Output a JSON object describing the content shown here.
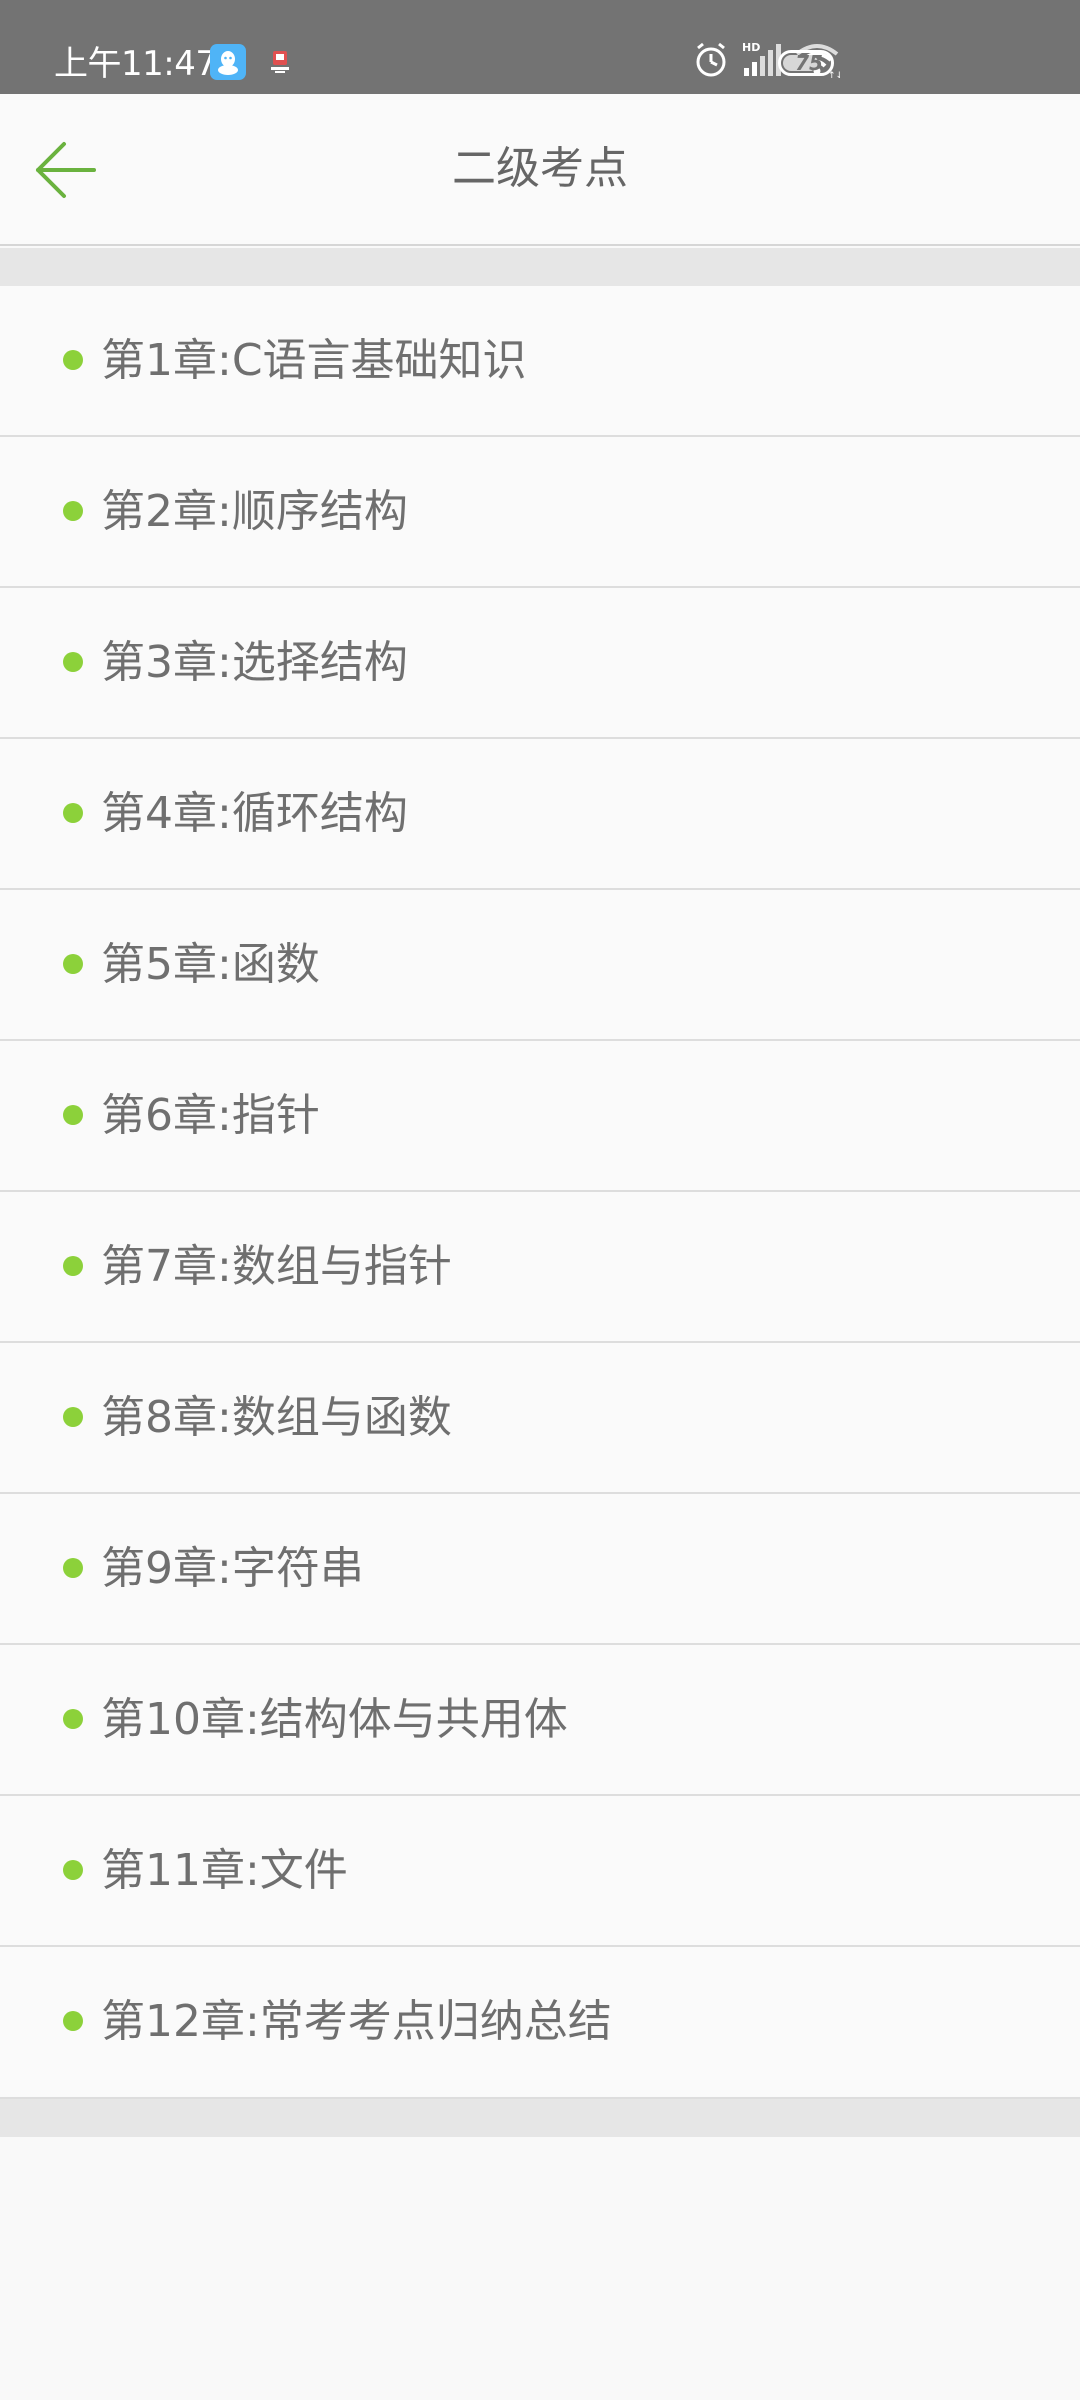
{
  "status_bar": {
    "time": "上午11:47",
    "battery": "75",
    "battery_fraction": 0.75,
    "icons": [
      "qq-icon",
      "notification-app-icon",
      "alarm-icon",
      "hd-signal-icon",
      "wifi-icon",
      "battery-icon"
    ]
  },
  "header": {
    "title": "二级考点",
    "back_icon": "arrow-left-icon",
    "accent_color": "#6ab23e"
  },
  "chapters": [
    {
      "label": "第1章:C语言基础知识"
    },
    {
      "label": "第2章:顺序结构"
    },
    {
      "label": "第3章:选择结构"
    },
    {
      "label": "第4章:循环结构"
    },
    {
      "label": "第5章:函数"
    },
    {
      "label": "第6章:指针"
    },
    {
      "label": "第7章:数组与指针"
    },
    {
      "label": "第8章:数组与函数"
    },
    {
      "label": "第9章:字符串"
    },
    {
      "label": "第10章:结构体与共用体"
    },
    {
      "label": "第11章:文件"
    },
    {
      "label": "第12章:常考考点归纳总结"
    }
  ],
  "colors": {
    "bullet": "#8cd13a",
    "status_bar_bg": "#737373",
    "text": "#6f6f6f"
  }
}
